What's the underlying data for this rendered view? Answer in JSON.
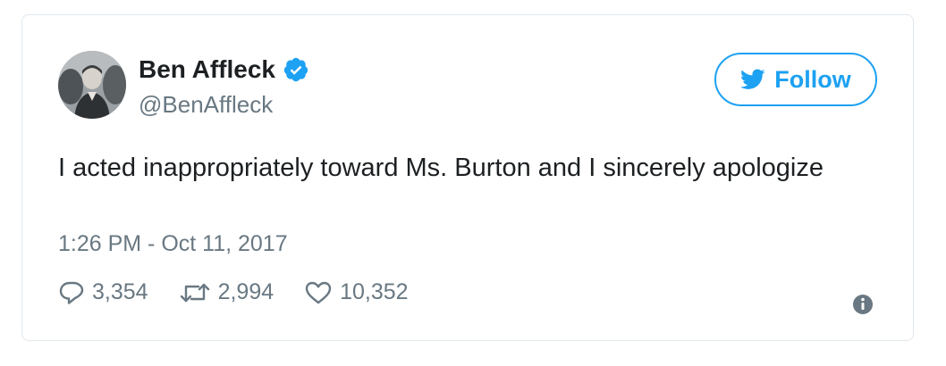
{
  "user": {
    "display_name": "Ben Affleck",
    "handle": "@BenAffleck",
    "verified": true,
    "avatar_icon": "user-avatar-photo"
  },
  "follow_button": {
    "label": "Follow",
    "icon": "twitter-bird-icon"
  },
  "tweet": {
    "text": "I acted inappropriately toward Ms. Burton and I sincerely apologize",
    "timestamp": "1:26 PM - Oct 11, 2017"
  },
  "actions": {
    "replies": "3,354",
    "retweets": "2,994",
    "likes": "10,352"
  },
  "colors": {
    "brand_blue": "#1da1f2",
    "text_primary": "#1c2022",
    "text_secondary": "#697882",
    "border": "#e1e8ed"
  }
}
